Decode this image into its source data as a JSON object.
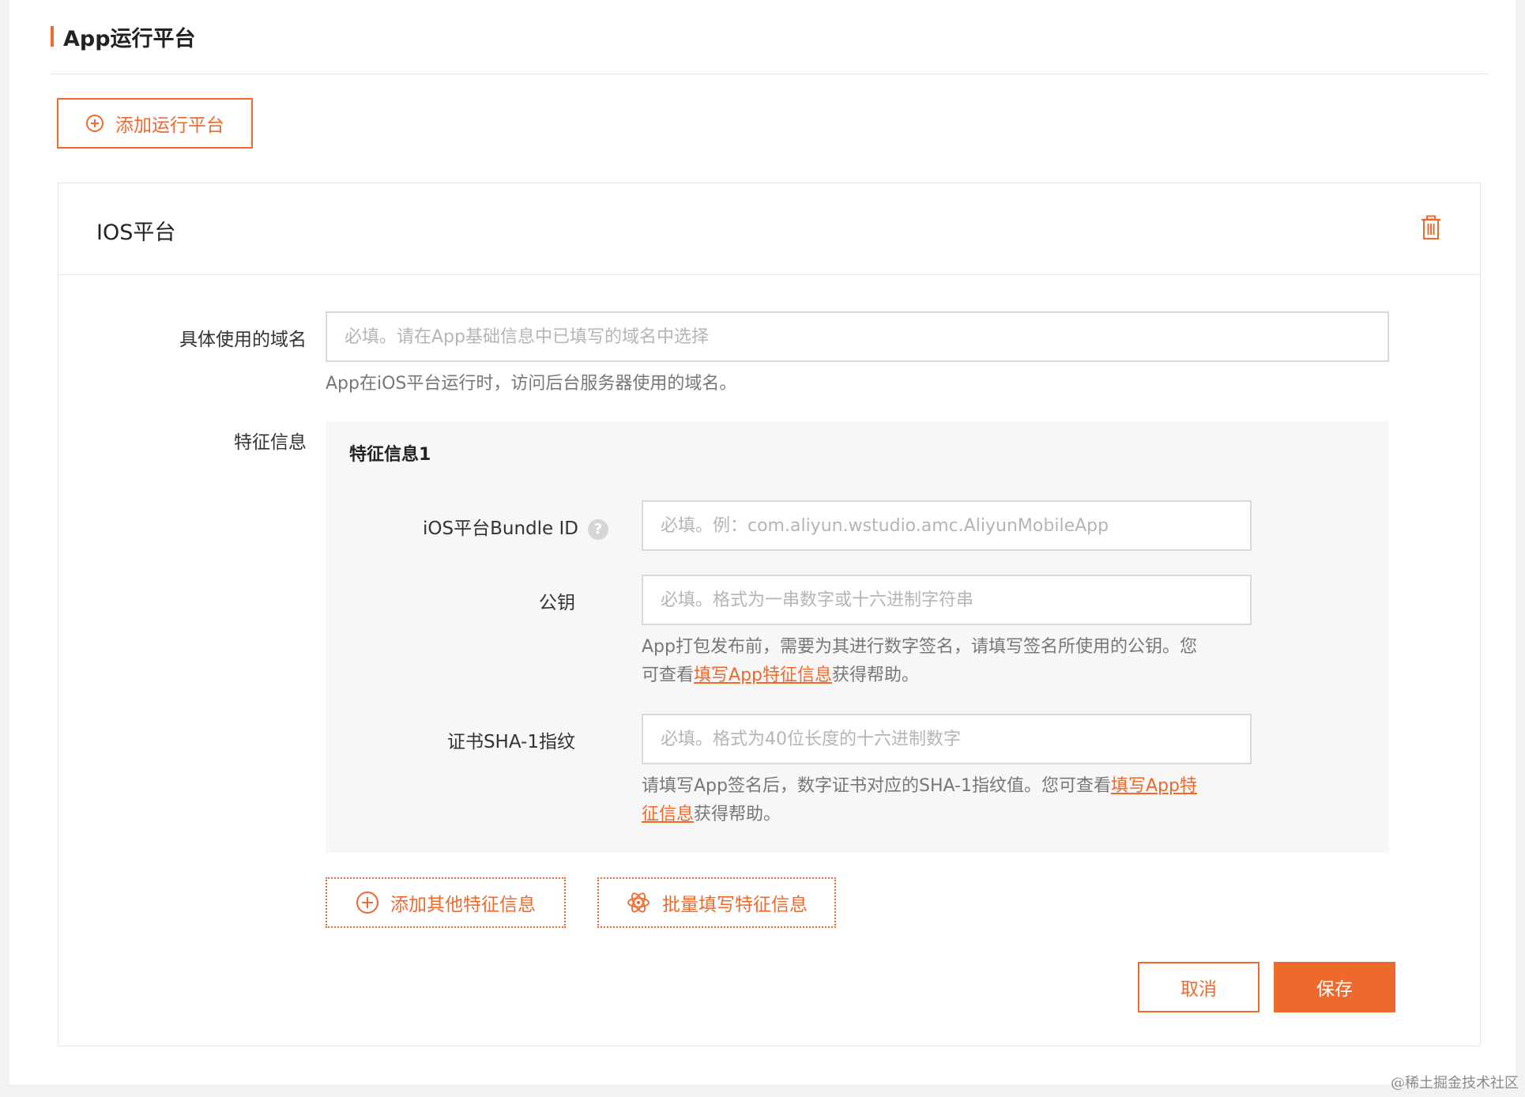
{
  "section": {
    "title": "App运行平台",
    "add_platform_label": "添加运行平台"
  },
  "platform_card": {
    "title": "IOS平台",
    "domain": {
      "label": "具体使用的域名",
      "placeholder": "必填。请在App基础信息中已填写的域名中选择",
      "hint": "App在iOS平台运行时，访问后台服务器使用的域名。"
    },
    "features": {
      "label": "特征信息",
      "group_title": "特征信息1",
      "bundle_id": {
        "label": "iOS平台Bundle ID",
        "help": "?",
        "placeholder": "必填。例：com.aliyun.wstudio.amc.AliyunMobileApp"
      },
      "public_key": {
        "label": "公钥",
        "placeholder": "必填。格式为一串数字或十六进制字符串",
        "hint_line1": "App打包发布前，需要为其进行数字签名，请填写签名所使用的公钥。您",
        "hint_line2_prefix": "可查看",
        "hint_link": "填写App特征信息",
        "hint_suffix": "获得帮助。"
      },
      "sha1": {
        "label": "证书SHA-1指纹",
        "placeholder": "必填。格式为40位长度的十六进制数字",
        "hint_prefix": "请填写App签名后，数字证书对应的SHA-1指纹值。您可查看",
        "hint_link_part1": "填写App特",
        "hint_link_part2": "征信息",
        "hint_suffix": "获得帮助。"
      }
    },
    "add_feature_label": "添加其他特征信息",
    "batch_fill_label": "批量填写特征信息",
    "cancel_label": "取消",
    "save_label": "保存"
  },
  "watermark": "@稀土掘金技术社区",
  "colors": {
    "accent": "#ed6a2c",
    "border": "#d9d9d9",
    "feature_bg": "#f7f7f7"
  }
}
